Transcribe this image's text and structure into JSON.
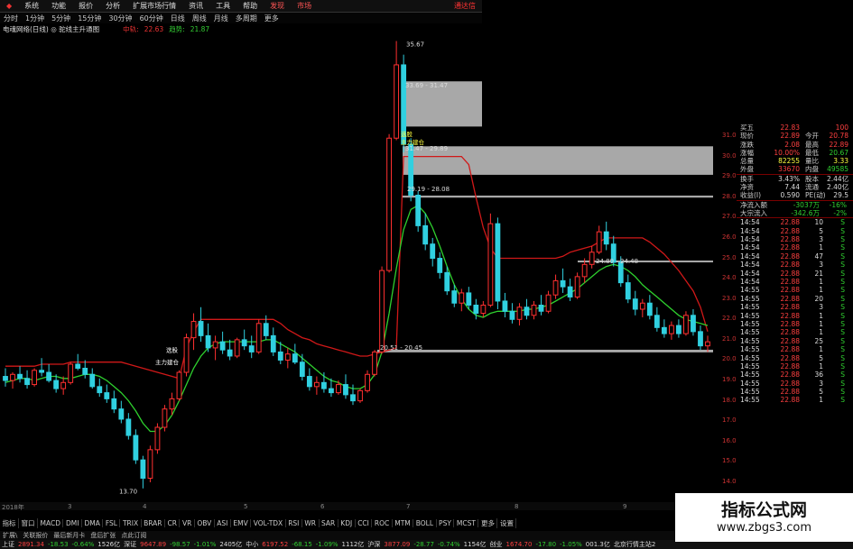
{
  "menu": {
    "items": [
      "系统",
      "功能",
      "报价",
      "分析",
      "扩展市场行情",
      "资讯",
      "工具",
      "帮助"
    ],
    "tabs": [
      "发现",
      "市场"
    ],
    "window_btn": "通达信"
  },
  "toolbar": {
    "items": [
      "分时",
      "1分钟",
      "5分钟",
      "15分钟",
      "30分钟",
      "60分钟",
      "日线",
      "周线",
      "月线",
      "多周期",
      "更多"
    ]
  },
  "info": {
    "title": "电魂网络(日线) ◎ 驼线主升通图",
    "k1_label": "中轨:",
    "k1_value": "22.63",
    "k2_label": "趋势:",
    "k2_value": "21.87"
  },
  "chart_data": {
    "type": "candlestick",
    "ylim": [
      13.0,
      32.0
    ],
    "price_ticks": [
      31.0,
      30.0,
      29.0,
      28.0,
      27.0,
      26.0,
      25.0,
      24.0,
      23.0,
      22.0,
      21.0,
      20.0,
      19.0,
      18.0,
      17.0,
      16.0,
      15.0,
      14.0
    ],
    "annotations": [
      {
        "text": "35.67"
      },
      {
        "text": "33.69 - 31.47"
      },
      {
        "text": "31.47 - 29.89"
      },
      {
        "text": "29.19 - 28.08"
      },
      {
        "text": "24.89 - 24.48"
      },
      {
        "text": "20.51 - 20.45"
      },
      {
        "text": "13.70"
      }
    ],
    "grey_zones": [
      {
        "top": 33.69,
        "bottom": 31.47
      },
      {
        "top": 30.5,
        "bottom": 29.1
      },
      {
        "top": 28.08,
        "bottom": 27.98
      },
      {
        "top": 24.89,
        "bottom": 24.8
      },
      {
        "top": 20.51,
        "bottom": 20.38
      }
    ],
    "candles": [
      {
        "o": 19.2,
        "h": 19.6,
        "l": 18.7,
        "c": 19.0
      },
      {
        "o": 19.0,
        "h": 19.4,
        "l": 18.6,
        "c": 19.3
      },
      {
        "o": 19.3,
        "h": 19.7,
        "l": 18.9,
        "c": 19.1
      },
      {
        "o": 19.1,
        "h": 19.5,
        "l": 18.6,
        "c": 18.8
      },
      {
        "o": 18.8,
        "h": 19.6,
        "l": 18.7,
        "c": 19.5
      },
      {
        "o": 19.5,
        "h": 20.1,
        "l": 19.2,
        "c": 19.4
      },
      {
        "o": 19.4,
        "h": 19.8,
        "l": 18.9,
        "c": 19.0
      },
      {
        "o": 19.0,
        "h": 19.3,
        "l": 18.4,
        "c": 18.6
      },
      {
        "o": 18.6,
        "h": 19.2,
        "l": 18.3,
        "c": 18.9
      },
      {
        "o": 18.9,
        "h": 19.9,
        "l": 18.8,
        "c": 19.8
      },
      {
        "o": 19.8,
        "h": 20.3,
        "l": 19.5,
        "c": 19.6
      },
      {
        "o": 19.6,
        "h": 20.0,
        "l": 19.1,
        "c": 19.3
      },
      {
        "o": 19.3,
        "h": 19.6,
        "l": 18.6,
        "c": 18.7
      },
      {
        "o": 18.7,
        "h": 19.1,
        "l": 18.2,
        "c": 18.4
      },
      {
        "o": 18.4,
        "h": 18.8,
        "l": 17.9,
        "c": 18.1
      },
      {
        "o": 18.1,
        "h": 18.5,
        "l": 17.4,
        "c": 17.6
      },
      {
        "o": 17.6,
        "h": 18.0,
        "l": 16.9,
        "c": 17.1
      },
      {
        "o": 17.1,
        "h": 17.4,
        "l": 16.1,
        "c": 16.3
      },
      {
        "o": 16.3,
        "h": 16.6,
        "l": 14.9,
        "c": 15.1
      },
      {
        "o": 15.1,
        "h": 15.3,
        "l": 13.7,
        "c": 14.2
      },
      {
        "o": 14.2,
        "h": 15.8,
        "l": 14.0,
        "c": 15.6
      },
      {
        "o": 15.6,
        "h": 16.9,
        "l": 15.4,
        "c": 16.7
      },
      {
        "o": 16.7,
        "h": 17.8,
        "l": 16.5,
        "c": 17.6
      },
      {
        "o": 17.6,
        "h": 18.4,
        "l": 17.3,
        "c": 18.1
      },
      {
        "o": 18.1,
        "h": 19.5,
        "l": 18.0,
        "c": 19.4
      },
      {
        "o": 19.4,
        "h": 21.3,
        "l": 19.2,
        "c": 21.1
      },
      {
        "o": 21.1,
        "h": 22.3,
        "l": 20.5,
        "c": 21.9
      },
      {
        "o": 21.9,
        "h": 22.6,
        "l": 20.9,
        "c": 21.2
      },
      {
        "o": 21.2,
        "h": 21.8,
        "l": 20.4,
        "c": 20.6
      },
      {
        "o": 20.6,
        "h": 21.2,
        "l": 20.0,
        "c": 20.9
      },
      {
        "o": 20.9,
        "h": 21.4,
        "l": 20.3,
        "c": 20.5
      },
      {
        "o": 20.5,
        "h": 21.0,
        "l": 20.0,
        "c": 20.2
      },
      {
        "o": 20.2,
        "h": 21.1,
        "l": 20.1,
        "c": 21.0
      },
      {
        "o": 21.0,
        "h": 21.5,
        "l": 20.5,
        "c": 20.7
      },
      {
        "o": 20.7,
        "h": 21.2,
        "l": 20.1,
        "c": 20.4
      },
      {
        "o": 20.4,
        "h": 22.0,
        "l": 20.3,
        "c": 21.8
      },
      {
        "o": 21.8,
        "h": 22.2,
        "l": 21.0,
        "c": 21.2
      },
      {
        "o": 21.2,
        "h": 21.6,
        "l": 20.2,
        "c": 20.4
      },
      {
        "o": 20.4,
        "h": 20.9,
        "l": 19.8,
        "c": 20.0
      },
      {
        "o": 20.0,
        "h": 20.6,
        "l": 19.6,
        "c": 20.3
      },
      {
        "o": 20.3,
        "h": 20.8,
        "l": 19.8,
        "c": 19.9
      },
      {
        "o": 19.9,
        "h": 20.3,
        "l": 19.0,
        "c": 19.2
      },
      {
        "o": 19.2,
        "h": 19.6,
        "l": 18.5,
        "c": 18.7
      },
      {
        "o": 18.7,
        "h": 19.2,
        "l": 18.3,
        "c": 18.9
      },
      {
        "o": 18.9,
        "h": 19.4,
        "l": 18.4,
        "c": 18.6
      },
      {
        "o": 18.6,
        "h": 19.1,
        "l": 18.2,
        "c": 18.4
      },
      {
        "o": 18.4,
        "h": 19.0,
        "l": 18.3,
        "c": 18.8
      },
      {
        "o": 18.8,
        "h": 19.3,
        "l": 18.1,
        "c": 18.3
      },
      {
        "o": 18.3,
        "h": 18.8,
        "l": 17.8,
        "c": 18.0
      },
      {
        "o": 18.0,
        "h": 18.6,
        "l": 17.9,
        "c": 18.5
      },
      {
        "o": 18.5,
        "h": 19.5,
        "l": 18.4,
        "c": 19.3
      },
      {
        "o": 19.3,
        "h": 20.5,
        "l": 19.2,
        "c": 20.4
      },
      {
        "o": 20.4,
        "h": 24.6,
        "l": 20.3,
        "c": 24.4
      },
      {
        "o": 24.4,
        "h": 31.1,
        "l": 24.3,
        "c": 30.9
      },
      {
        "o": 30.9,
        "h": 35.67,
        "l": 30.8,
        "c": 34.5
      },
      {
        "o": 34.5,
        "h": 35.0,
        "l": 30.2,
        "c": 30.6
      },
      {
        "o": 30.6,
        "h": 30.9,
        "l": 27.8,
        "c": 28.1
      },
      {
        "o": 28.1,
        "h": 28.3,
        "l": 26.3,
        "c": 26.6
      },
      {
        "o": 26.6,
        "h": 27.2,
        "l": 25.4,
        "c": 25.7
      },
      {
        "o": 25.7,
        "h": 26.0,
        "l": 24.6,
        "c": 25.0
      },
      {
        "o": 25.0,
        "h": 25.3,
        "l": 24.0,
        "c": 24.3
      },
      {
        "o": 24.3,
        "h": 24.6,
        "l": 23.2,
        "c": 23.4
      },
      {
        "o": 23.4,
        "h": 23.7,
        "l": 22.6,
        "c": 22.8
      },
      {
        "o": 22.8,
        "h": 23.5,
        "l": 22.4,
        "c": 23.3
      },
      {
        "o": 23.3,
        "h": 23.6,
        "l": 22.5,
        "c": 22.7
      },
      {
        "o": 22.7,
        "h": 23.0,
        "l": 22.0,
        "c": 22.3
      },
      {
        "o": 22.3,
        "h": 22.9,
        "l": 22.1,
        "c": 22.7
      },
      {
        "o": 22.7,
        "h": 27.2,
        "l": 22.6,
        "c": 26.7
      },
      {
        "o": 26.7,
        "h": 27.0,
        "l": 22.5,
        "c": 22.9
      },
      {
        "o": 22.9,
        "h": 23.3,
        "l": 22.1,
        "c": 22.4
      },
      {
        "o": 22.4,
        "h": 22.8,
        "l": 21.8,
        "c": 22.0
      },
      {
        "o": 22.0,
        "h": 22.8,
        "l": 21.7,
        "c": 22.6
      },
      {
        "o": 22.6,
        "h": 23.0,
        "l": 22.0,
        "c": 22.2
      },
      {
        "o": 22.2,
        "h": 22.9,
        "l": 22.0,
        "c": 22.7
      },
      {
        "o": 22.7,
        "h": 23.2,
        "l": 22.2,
        "c": 22.4
      },
      {
        "o": 22.4,
        "h": 23.4,
        "l": 22.3,
        "c": 23.2
      },
      {
        "o": 23.2,
        "h": 24.2,
        "l": 23.0,
        "c": 23.9
      },
      {
        "o": 23.9,
        "h": 24.5,
        "l": 23.3,
        "c": 23.6
      },
      {
        "o": 23.6,
        "h": 24.0,
        "l": 22.9,
        "c": 23.1
      },
      {
        "o": 23.1,
        "h": 24.3,
        "l": 23.0,
        "c": 24.1
      },
      {
        "o": 24.1,
        "h": 25.0,
        "l": 23.8,
        "c": 24.7
      },
      {
        "o": 24.7,
        "h": 25.6,
        "l": 24.5,
        "c": 25.3
      },
      {
        "o": 25.3,
        "h": 26.6,
        "l": 25.2,
        "c": 26.3
      },
      {
        "o": 26.3,
        "h": 26.8,
        "l": 25.4,
        "c": 25.7
      },
      {
        "o": 25.7,
        "h": 26.1,
        "l": 24.6,
        "c": 24.8
      },
      {
        "o": 24.8,
        "h": 25.1,
        "l": 23.6,
        "c": 23.8
      },
      {
        "o": 23.8,
        "h": 24.2,
        "l": 22.8,
        "c": 23.0
      },
      {
        "o": 23.0,
        "h": 23.4,
        "l": 22.2,
        "c": 22.5
      },
      {
        "o": 22.5,
        "h": 23.0,
        "l": 22.1,
        "c": 22.8
      },
      {
        "o": 22.8,
        "h": 23.2,
        "l": 22.0,
        "c": 22.2
      },
      {
        "o": 22.2,
        "h": 22.6,
        "l": 21.4,
        "c": 21.6
      },
      {
        "o": 21.6,
        "h": 22.0,
        "l": 21.1,
        "c": 21.3
      },
      {
        "o": 21.3,
        "h": 21.9,
        "l": 21.0,
        "c": 21.7
      },
      {
        "o": 21.7,
        "h": 22.0,
        "l": 21.1,
        "c": 21.3
      },
      {
        "o": 21.3,
        "h": 22.4,
        "l": 21.2,
        "c": 22.2
      },
      {
        "o": 22.2,
        "h": 22.5,
        "l": 21.2,
        "c": 21.4
      },
      {
        "o": 21.4,
        "h": 21.7,
        "l": 20.5,
        "c": 20.7
      },
      {
        "o": 20.7,
        "h": 21.2,
        "l": 20.4,
        "c": 20.9
      }
    ],
    "trend_green": [
      18.9,
      19.0,
      19.1,
      19.1,
      19.0,
      19.1,
      19.2,
      19.2,
      19.1,
      19.1,
      19.2,
      19.3,
      19.3,
      19.2,
      19.0,
      18.7,
      18.4,
      18.0,
      17.5,
      16.9,
      16.5,
      16.5,
      16.8,
      17.3,
      18.0,
      18.8,
      19.6,
      20.2,
      20.6,
      20.8,
      20.9,
      20.9,
      20.9,
      20.9,
      20.9,
      20.9,
      21.0,
      21.0,
      20.8,
      20.6,
      20.4,
      20.1,
      19.8,
      19.5,
      19.2,
      19.0,
      18.9,
      18.7,
      18.6,
      18.6,
      18.8,
      19.3,
      20.4,
      22.3,
      24.5,
      26.4,
      27.4,
      27.6,
      27.2,
      26.5,
      25.6,
      24.6,
      23.7,
      23.0,
      22.5,
      22.2,
      22.1,
      22.3,
      22.4,
      22.4,
      22.4,
      22.4,
      22.5,
      22.5,
      22.6,
      22.7,
      22.9,
      23.1,
      23.3,
      23.5,
      23.8,
      24.1,
      24.4,
      24.6,
      24.7,
      24.6,
      24.4,
      24.1,
      23.7,
      23.4,
      23.1,
      22.8,
      22.5,
      22.2,
      22.0,
      21.9,
      21.8,
      21.7
    ],
    "trend_red": [
      19.7,
      19.7,
      19.7,
      19.7,
      19.7,
      19.8,
      19.8,
      19.8,
      19.8,
      19.9,
      19.9,
      19.9,
      19.9,
      19.9,
      19.9,
      19.9,
      19.9,
      19.8,
      19.7,
      19.6,
      19.5,
      19.4,
      19.3,
      19.2,
      19.1,
      20.6,
      21.4,
      22.0,
      22.0,
      22.0,
      22.0,
      22.0,
      22.0,
      22.0,
      22.0,
      22.0,
      22.0,
      22.0,
      21.8,
      21.5,
      21.3,
      21.1,
      21.0,
      20.8,
      20.7,
      20.6,
      20.5,
      20.4,
      20.3,
      20.2,
      20.2,
      20.3,
      20.4,
      20.5,
      20.6,
      30.0,
      30.0,
      30.0,
      30.0,
      30.0,
      30.0,
      30.0,
      30.0,
      30.0,
      29.6,
      28.0,
      26.5,
      25.5,
      25.0,
      25.0,
      25.0,
      25.0,
      25.0,
      25.0,
      25.0,
      25.0,
      25.0,
      25.1,
      25.3,
      25.4,
      25.5,
      25.6,
      25.8,
      26.0,
      26.0,
      26.0,
      26.0,
      26.0,
      26.0,
      25.8,
      25.5,
      25.2,
      24.8,
      24.4,
      23.9,
      23.4,
      22.6,
      21.4
    ],
    "labels_on_chart": [
      "选股",
      "主力建仓",
      "选股",
      "主力建仓"
    ]
  },
  "quote": {
    "rows": [
      {
        "l1": "买五",
        "v1": "22.83",
        "l2": "",
        "v2": "100"
      },
      {
        "l1": "现价",
        "v1": "22.89",
        "l2": "今开",
        "v2": "20.78"
      },
      {
        "l1": "涨跌",
        "v1": "2.08",
        "l2": "最高",
        "v2": "22.89"
      },
      {
        "l1": "涨幅",
        "v1": "10.00%",
        "l2": "最低",
        "v2": "20.67"
      },
      {
        "l1": "总量",
        "v1": "82255",
        "l2": "量比",
        "v2": "3.33"
      },
      {
        "l1": "外盘",
        "v1": "33670",
        "l2": "内盘",
        "v2": "49585"
      }
    ],
    "rows2": [
      {
        "l1": "换手",
        "v1": "3.43%",
        "l2": "股本",
        "v2": "2.44亿"
      },
      {
        "l1": "净资",
        "v1": "7.44",
        "l2": "流通",
        "v2": "2.40亿"
      },
      {
        "l1": "收益(I)",
        "v1": "0.590",
        "l2": "PE(动)",
        "v2": "29.5"
      }
    ],
    "flows": [
      {
        "l": "净流入额",
        "v": "-3037万",
        "p": "-16%"
      },
      {
        "l": "大宗流入",
        "v": "-342.6万",
        "p": "-2%"
      }
    ],
    "ticks": [
      {
        "t": "14:54",
        "p": "22.88",
        "v": "10",
        "f": "S"
      },
      {
        "t": "14:54",
        "p": "22.88",
        "v": "5",
        "f": "S"
      },
      {
        "t": "14:54",
        "p": "22.88",
        "v": "3",
        "f": "S"
      },
      {
        "t": "14:54",
        "p": "22.88",
        "v": "1",
        "f": "S"
      },
      {
        "t": "14:54",
        "p": "22.88",
        "v": "47",
        "f": "S"
      },
      {
        "t": "14:54",
        "p": "22.88",
        "v": "3",
        "f": "S"
      },
      {
        "t": "14:54",
        "p": "22.88",
        "v": "21",
        "f": "S"
      },
      {
        "t": "14:54",
        "p": "22.88",
        "v": "1",
        "f": "S"
      },
      {
        "t": "14:55",
        "p": "22.88",
        "v": "1",
        "f": "S"
      },
      {
        "t": "14:55",
        "p": "22.88",
        "v": "20",
        "f": "S"
      },
      {
        "t": "14:55",
        "p": "22.88",
        "v": "3",
        "f": "S"
      },
      {
        "t": "14:55",
        "p": "22.88",
        "v": "1",
        "f": "S"
      },
      {
        "t": "14:55",
        "p": "22.88",
        "v": "1",
        "f": "S"
      },
      {
        "t": "14:55",
        "p": "22.88",
        "v": "1",
        "f": "S"
      },
      {
        "t": "14:55",
        "p": "22.88",
        "v": "25",
        "f": "S"
      },
      {
        "t": "14:55",
        "p": "22.88",
        "v": "1",
        "f": "S"
      },
      {
        "t": "14:55",
        "p": "22.88",
        "v": "5",
        "f": "S"
      },
      {
        "t": "14:55",
        "p": "22.88",
        "v": "1",
        "f": "S"
      },
      {
        "t": "14:55",
        "p": "22.88",
        "v": "36",
        "f": "S"
      },
      {
        "t": "14:55",
        "p": "22.88",
        "v": "3",
        "f": "S"
      },
      {
        "t": "14:55",
        "p": "22.88",
        "v": "5",
        "f": "S"
      },
      {
        "t": "14:55",
        "p": "22.88",
        "v": "1",
        "f": "S"
      }
    ]
  },
  "date_axis": [
    "2018年",
    "3",
    "4",
    "5",
    "6",
    "7",
    "8",
    "9"
  ],
  "indicators": [
    "指标",
    "窗口",
    "MACD",
    "DMI",
    "DMA",
    "FSL",
    "TRIX",
    "BRAR",
    "CR",
    "VR",
    "OBV",
    "ASI",
    "EMV",
    "VOL-TDX",
    "RSI",
    "WR",
    "SAR",
    "KDJ",
    "CCI",
    "ROC",
    "MTM",
    "BOLL",
    "PSY",
    "MCST",
    "更多",
    "设置"
  ],
  "status1": [
    "扩展\\",
    "关联报价",
    "最后新月卡",
    "盘后扩张",
    "点此订阅"
  ],
  "status2": [
    {
      "text": "上证",
      "c": "#ddd"
    },
    {
      "text": "2891.34",
      "c": "#ff4040"
    },
    {
      "text": "-18.53",
      "c": "#30d030"
    },
    {
      "text": "-0.64%",
      "c": "#30d030"
    },
    {
      "text": "1526亿",
      "c": "#ddd"
    },
    {
      "text": "深证",
      "c": "#ddd"
    },
    {
      "text": "9647.89",
      "c": "#ff4040"
    },
    {
      "text": "-98.57",
      "c": "#30d030"
    },
    {
      "text": "-1.01%",
      "c": "#30d030"
    },
    {
      "text": "2405亿",
      "c": "#ddd"
    },
    {
      "text": "中小",
      "c": "#ddd"
    },
    {
      "text": "6197.52",
      "c": "#ff4040"
    },
    {
      "text": "-68.15",
      "c": "#30d030"
    },
    {
      "text": "-1.09%",
      "c": "#30d030"
    },
    {
      "text": "1112亿",
      "c": "#ddd"
    },
    {
      "text": "沪深",
      "c": "#ddd"
    },
    {
      "text": "3877.09",
      "c": "#ff4040"
    },
    {
      "text": "-28.77",
      "c": "#30d030"
    },
    {
      "text": "-0.74%",
      "c": "#30d030"
    },
    {
      "text": "1154亿",
      "c": "#ddd"
    },
    {
      "text": "创业",
      "c": "#ddd"
    },
    {
      "text": "1674.70",
      "c": "#ff4040"
    },
    {
      "text": "-17.80",
      "c": "#30d030"
    },
    {
      "text": "-1.05%",
      "c": "#30d030"
    },
    {
      "text": "001.3亿",
      "c": "#ddd"
    },
    {
      "text": "北京行情主站2",
      "c": "#ddd"
    }
  ],
  "watermark": {
    "line1": "指标公式网",
    "line2": "www.zbgs3.com"
  },
  "colors": {
    "up": "#ff3030",
    "down": "#30d0e0",
    "trend_green": "#2ed02e",
    "trend_red": "#d01818",
    "grey": "#a8a8a8"
  }
}
